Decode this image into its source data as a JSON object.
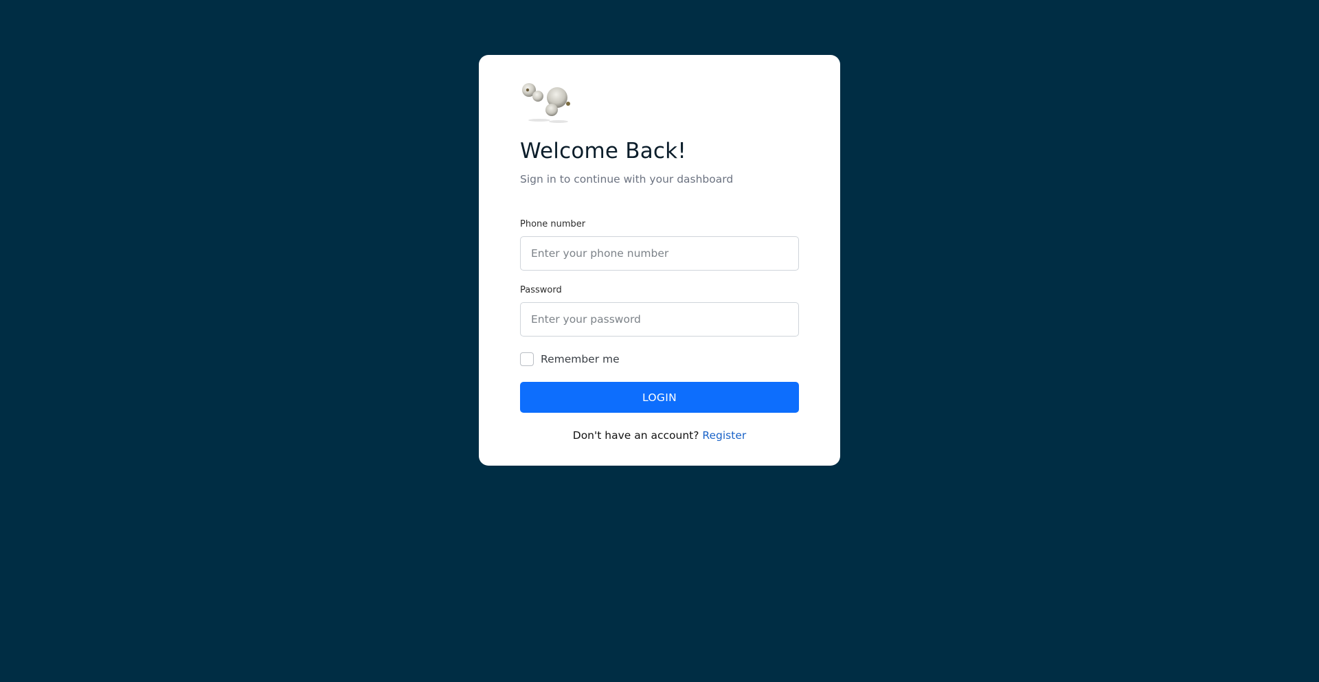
{
  "login": {
    "logo_icon": "earbuds-logo",
    "title": "Welcome Back!",
    "subtitle": "Sign in to continue with your dashboard",
    "phone": {
      "label": "Phone number",
      "placeholder": "Enter your phone number",
      "value": ""
    },
    "password": {
      "label": "Password",
      "placeholder": "Enter your password",
      "value": ""
    },
    "remember_label": "Remember me",
    "remember_checked": false,
    "login_button": "LOGIN",
    "no_account_text": "Don't have an account?",
    "register_link": "Register"
  },
  "colors": {
    "background": "#002d44",
    "card": "#ffffff",
    "primary": "#0d6efd",
    "link": "#1a63c8"
  }
}
